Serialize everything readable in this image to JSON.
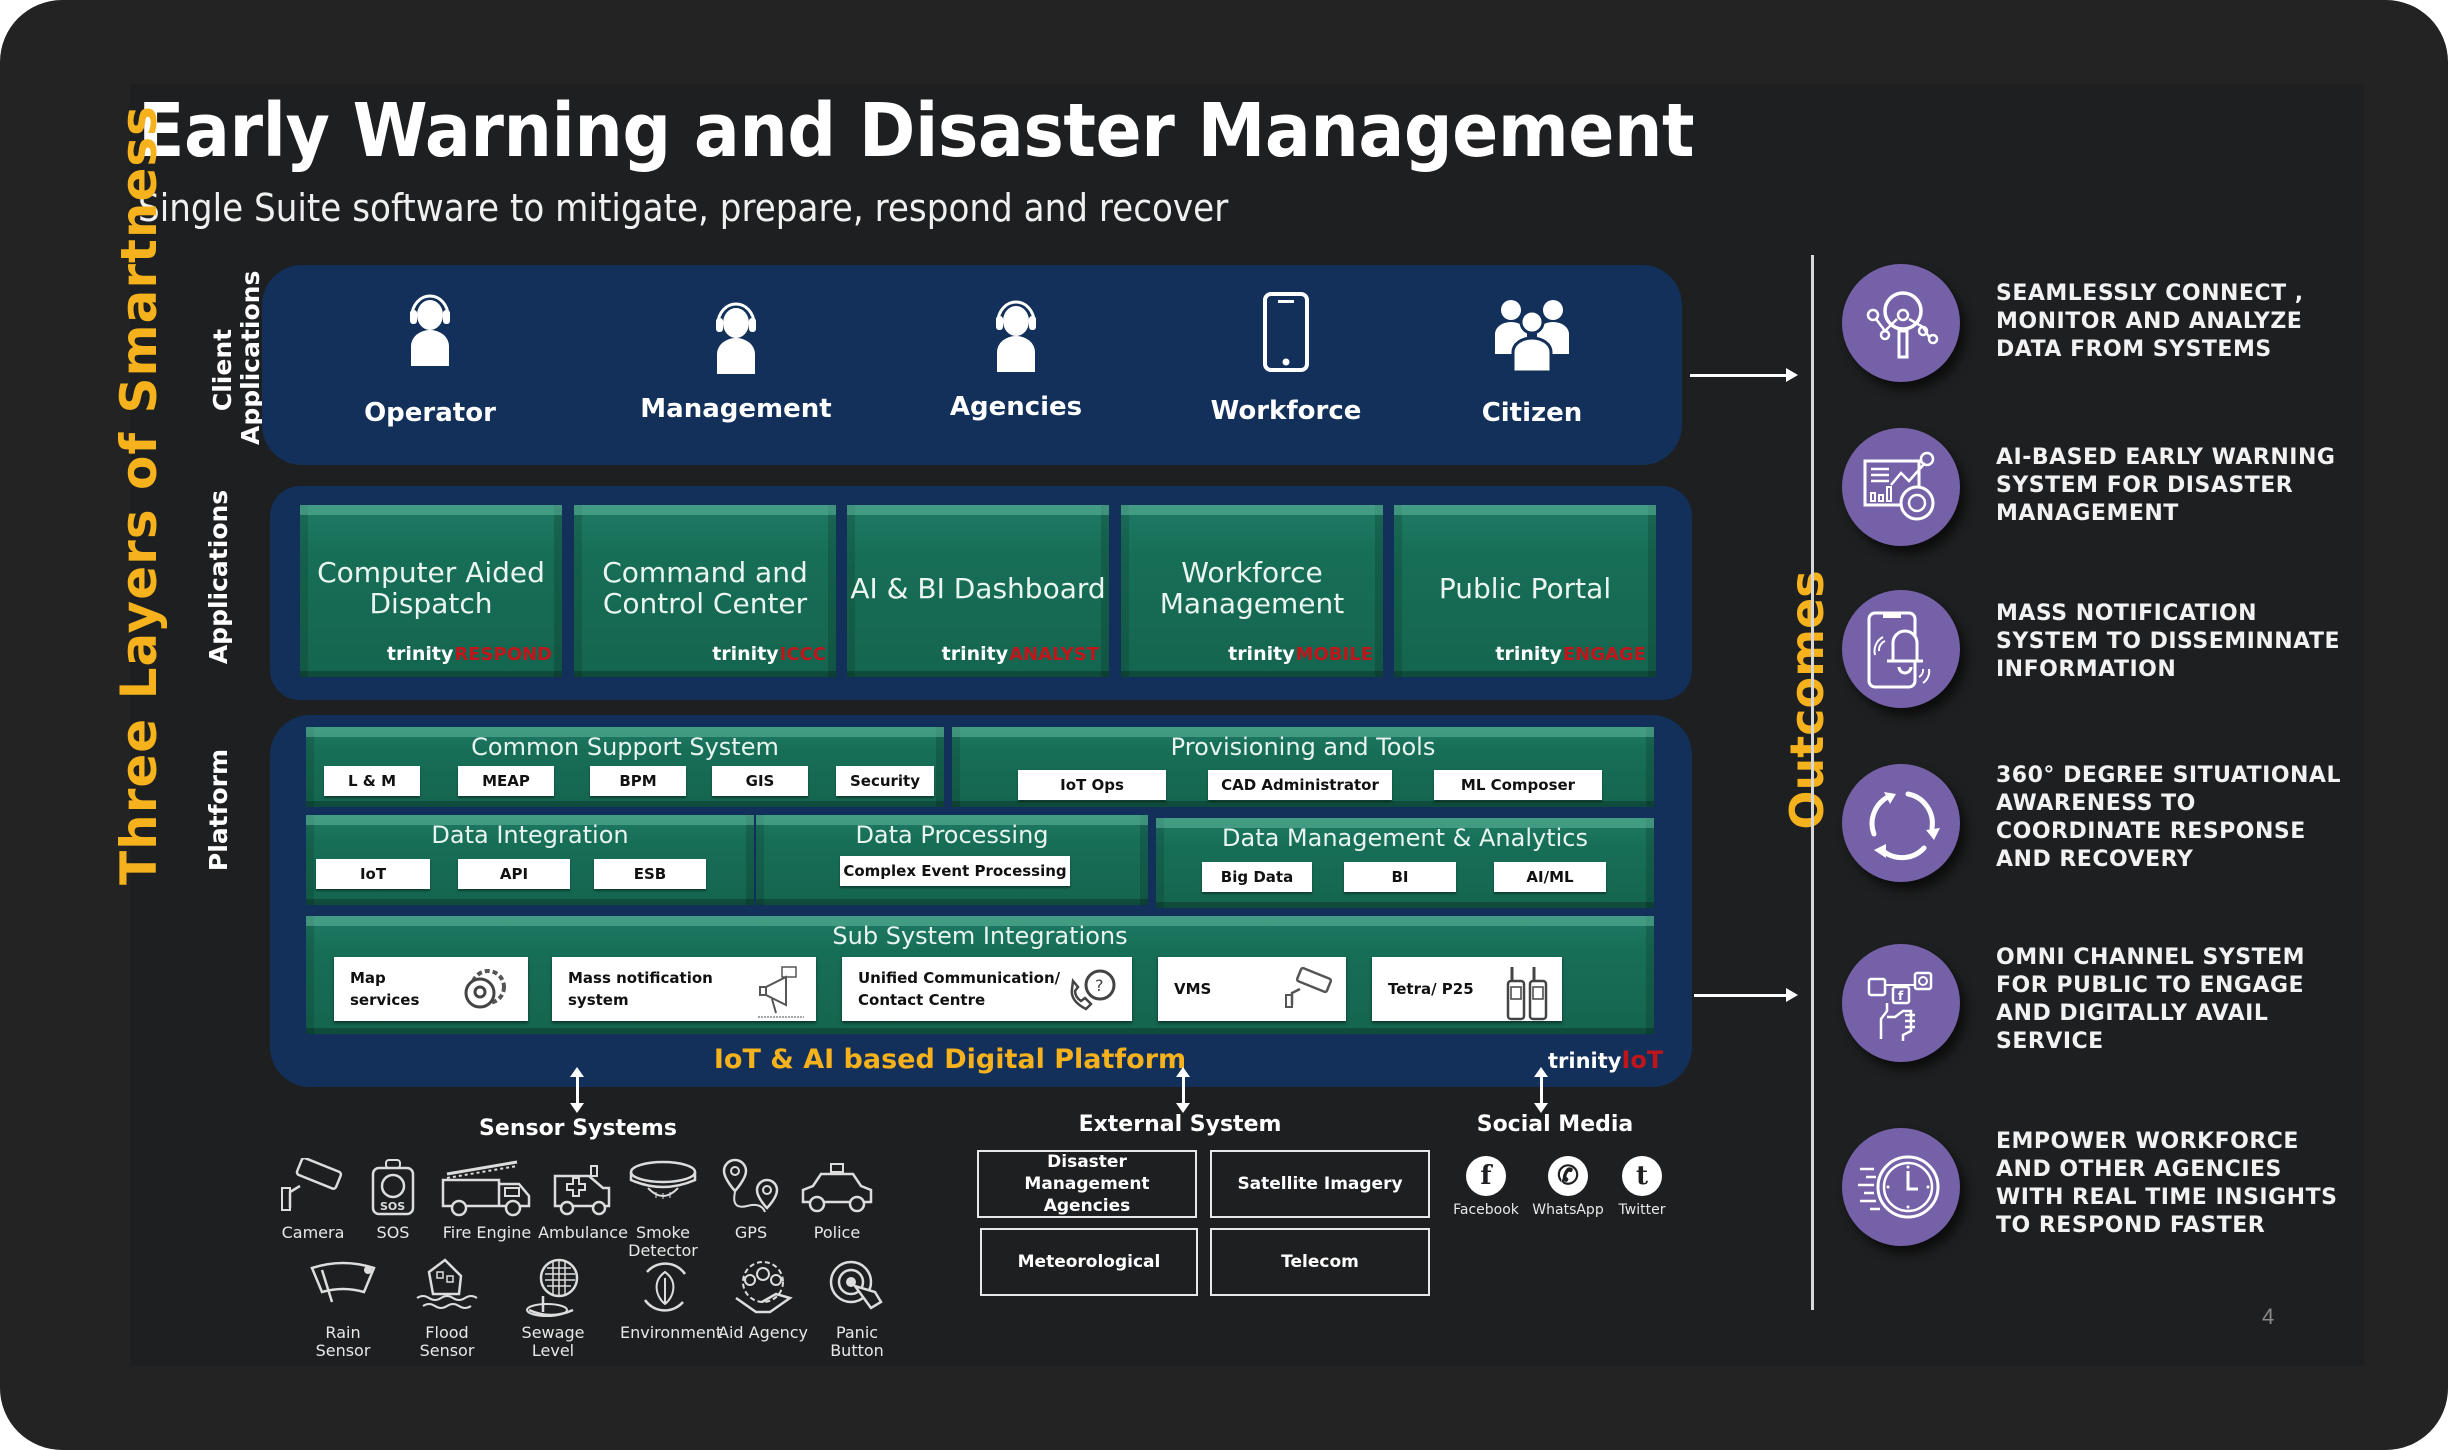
{
  "header": {
    "title": "Early Warning and Disaster Management",
    "subtitle": "Single Suite software to mitigate, prepare, respond and recover"
  },
  "side_labels": {
    "three_layers": "Three Layers of Smartness",
    "client_applications_line1": "Client",
    "client_applications_line2": "Applications",
    "applications": "Applications",
    "platform": "Platform",
    "outcomes": "Outcomes"
  },
  "client_applications": [
    {
      "label": "Operator",
      "icon": "headset-user-icon"
    },
    {
      "label": "Management",
      "icon": "headset-user-icon"
    },
    {
      "label": "Agencies",
      "icon": "headset-user-icon"
    },
    {
      "label": "Workforce",
      "icon": "mobile-phone-icon"
    },
    {
      "label": "Citizen",
      "icon": "group-people-icon"
    }
  ],
  "applications": [
    {
      "line1": "Computer Aided",
      "line2": "Dispatch",
      "brand": "trinity",
      "brand_suffix": "RESPOND"
    },
    {
      "line1": "Command and",
      "line2": "Control Center",
      "brand": "trinity",
      "brand_suffix": "ICCC"
    },
    {
      "line1": "AI & BI Dashboard",
      "line2": "",
      "brand": "trinity",
      "brand_suffix": "ANALYST"
    },
    {
      "line1": "Workforce",
      "line2": "Management",
      "brand": "trinity",
      "brand_suffix": "MOBILE"
    },
    {
      "line1": "Public Portal",
      "line2": "",
      "brand": "trinity",
      "brand_suffix": "ENGAGE"
    }
  ],
  "platform": {
    "common_support": {
      "title": "Common Support System",
      "items": [
        "L & M",
        "MEAP",
        "BPM",
        "GIS",
        "Security"
      ]
    },
    "provisioning": {
      "title": "Provisioning and Tools",
      "items": [
        "IoT Ops",
        "CAD Administrator",
        "ML Composer"
      ]
    },
    "data_integration": {
      "title": "Data Integration",
      "items": [
        "IoT",
        "API",
        "ESB"
      ]
    },
    "data_processing": {
      "title": "Data Processing",
      "items": [
        "Complex Event Processing"
      ]
    },
    "data_management": {
      "title": "Data Management & Analytics",
      "items": [
        "Big Data",
        "BI",
        "AI/ML"
      ]
    },
    "sub_system": {
      "title": "Sub System Integrations",
      "items": [
        {
          "line1": "Map",
          "line2": "services",
          "icon": "map-gear-icon"
        },
        {
          "line1": "Mass notification",
          "line2": "system",
          "icon": "megaphone-icon"
        },
        {
          "line1": "Unified Communication/",
          "line2": "Contact Centre",
          "icon": "phone-support-icon"
        },
        {
          "line1": "VMS",
          "line2": "",
          "icon": "cctv-camera-icon"
        },
        {
          "line1": "Tetra/ P25",
          "line2": "",
          "icon": "walkie-talkie-icon"
        }
      ]
    },
    "caption": "IoT & AI based Digital Platform",
    "brand": "trinity",
    "brand_suffix": "IoT"
  },
  "sensor_systems": {
    "title": "Sensor Systems",
    "row1": [
      "Camera",
      "SOS",
      "Fire Engine",
      "Ambulance",
      "Smoke Detector",
      "GPS",
      "Police"
    ],
    "row2": [
      "Rain Sensor",
      "Flood Sensor",
      "Sewage Level",
      "Environment",
      "Aid Agency",
      "Panic Button"
    ]
  },
  "external_system": {
    "title": "External System",
    "items": [
      "Disaster Management Agencies",
      "Satellite Imagery",
      "Meteorological",
      "Telecom"
    ]
  },
  "social_media": {
    "title": "Social Media",
    "items": [
      {
        "label": "Facebook",
        "glyph": "f"
      },
      {
        "label": "WhatsApp",
        "glyph": "✆"
      },
      {
        "label": "Twitter",
        "glyph": "t"
      }
    ]
  },
  "outcomes": [
    {
      "text": "SEAMLESSLY CONNECT , MONITOR AND ANALYZE DATA FROM SYSTEMS",
      "icon": "network-analysis-icon"
    },
    {
      "text": "AI-BASED EARLY WARNING SYSTEM FOR DISASTER MANAGEMENT",
      "icon": "dashboard-analytics-icon"
    },
    {
      "text": "MASS NOTIFICATION SYSTEM TO  DISSEMINNATE INFORMATION",
      "icon": "phone-bell-icon"
    },
    {
      "text": "360° DEGREE SITUATIONAL AWARENESS TO COORDINATE RESPONSE AND RECOVERY",
      "icon": "cycle-arrows-icon"
    },
    {
      "text": "OMNI CHANNEL SYSTEM FOR  PUBLIC TO ENGAGE AND DIGITALLY AVAIL SERVICE",
      "icon": "social-hand-icon"
    },
    {
      "text": "EMPOWER WORKFORCE AND OTHER AGENCIES WITH REAL TIME INSIGHTS TO RESPOND FASTER",
      "icon": "fast-clock-icon"
    }
  ],
  "page_number": "4",
  "colors": {
    "accent_yellow": "#f5b21c",
    "navy_panel": "#12305a",
    "teal_tile": "#176e57",
    "outcome_purple": "#7561a8",
    "brand_red": "#c0161b",
    "background": "#1e1f20"
  }
}
